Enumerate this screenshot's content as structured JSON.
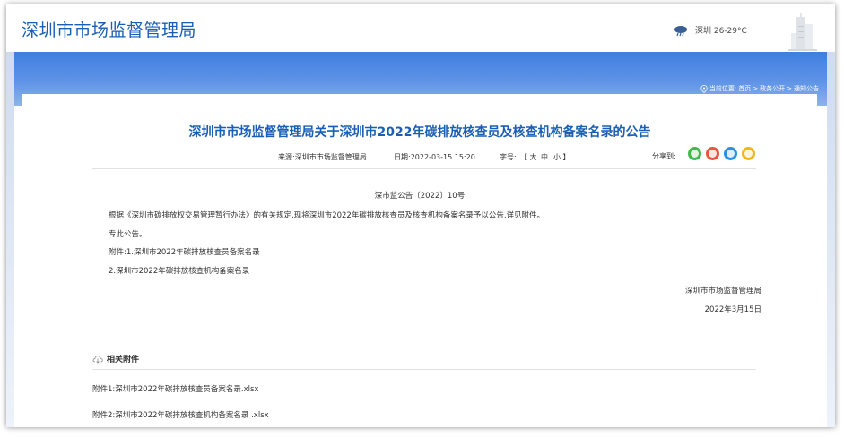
{
  "header": {
    "site_title": "深圳市市场监督管理局",
    "weather": "深圳 26-29°C",
    "weather_icon": "rain-cloud-icon",
    "building_icon": "building-icon"
  },
  "breadcrumb": {
    "prefix": "当前位置:",
    "items": [
      "首页",
      "政务公开",
      "通知公告"
    ],
    "separator": ">"
  },
  "article": {
    "title": "深圳市市场监督管理局关于深圳市2022年碳排放核查员及核查机构备案名录的公告",
    "source": "来源:深圳市市场监督管理局",
    "date": "日期:2022-03-15 15:20",
    "font_size_label": "字号:",
    "font_sizes": [
      "【 大",
      "中",
      "小 】"
    ],
    "share_label": "分享到:",
    "share_buttons": [
      {
        "name": "wechat-share-icon",
        "color": "#3fb94a"
      },
      {
        "name": "weibo-share-icon",
        "color": "#e8543f"
      },
      {
        "name": "qq-share-icon",
        "color": "#2c8fe6"
      },
      {
        "name": "qzone-share-icon",
        "color": "#f2b51c"
      }
    ],
    "doc_number": "深市监公告〔2022〕10号",
    "body1": "根据《深圳市碳排放权交易管理暂行办法》的有关规定,现将深圳市2022年碳排放核查员及核查机构备案名录予以公告,详见附件。",
    "body2": "专此公告。",
    "body3": "附件:1.深圳市2022年碳排放核查员备案名录",
    "body4": "2.深圳市2022年碳排放核查机构备案名录",
    "signature": "深圳市市场监督管理局",
    "sign_date": "2022年3月15日"
  },
  "attachments": {
    "heading": "相关附件",
    "items": [
      "附件1:深圳市2022年碳排放核查员备案名录.xlsx",
      "附件2:深圳市2022年碳排放核查机构备案名录 .xlsx"
    ]
  },
  "colors": {
    "brand": "#1a5fb4",
    "banner": "#4a86e3"
  }
}
